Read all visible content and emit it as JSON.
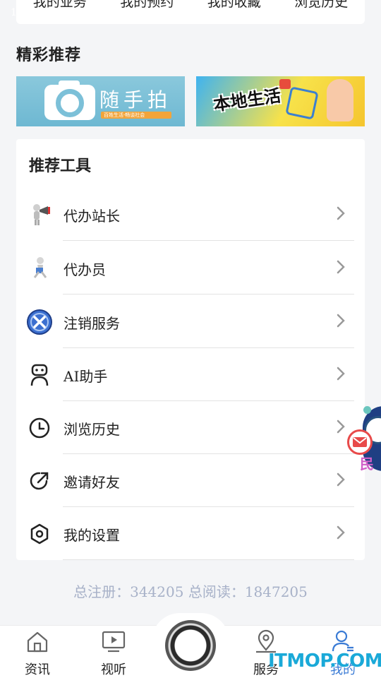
{
  "status": {
    "mark": "1"
  },
  "top_card": {
    "items": [
      "我的业务",
      "我的预约",
      "我的收藏",
      "浏览历史"
    ]
  },
  "recommend": {
    "title": "精彩推荐",
    "banners": [
      {
        "title": "随手拍",
        "subtitle": "百姓生活·畅谈社会"
      },
      {
        "title": "本地生活"
      }
    ]
  },
  "tools": {
    "title": "推荐工具",
    "items": [
      {
        "label": "代办站长",
        "icon": "megaphone-person-icon"
      },
      {
        "label": "代办员",
        "icon": "running-person-icon"
      },
      {
        "label": "注销服务",
        "icon": "cancel-x-icon"
      },
      {
        "label": "AI助手",
        "icon": "robot-icon"
      },
      {
        "label": "浏览历史",
        "icon": "clock-icon"
      },
      {
        "label": "邀请好友",
        "icon": "share-arrow-icon"
      },
      {
        "label": "我的设置",
        "icon": "settings-hexagon-icon"
      }
    ]
  },
  "float_widget": {
    "text": "民"
  },
  "stats": {
    "text": "总注册：344205 总阅读：1847205"
  },
  "tabbar": {
    "tabs": [
      {
        "label": "资讯",
        "icon": "home-icon"
      },
      {
        "label": "视听",
        "icon": "tv-icon"
      },
      {
        "label": "服务",
        "icon": "location-pin-icon"
      },
      {
        "label": "我的",
        "icon": "user-icon",
        "active": true
      }
    ]
  },
  "watermark": "ITMOP.COM",
  "colors": {
    "accent": "#3a7bd5",
    "stats_text": "#a7b1c8",
    "background": "#f4f5f7"
  }
}
